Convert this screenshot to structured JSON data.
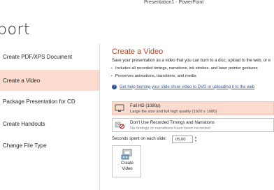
{
  "window": {
    "title": "Presentation1 - PowerPoint"
  },
  "page": {
    "heading": "port"
  },
  "nav": {
    "items": [
      {
        "label": "Create PDF/XPS Document"
      },
      {
        "label": "Create a Video"
      },
      {
        "label": "Package Presentation for CD"
      },
      {
        "label": "Create Handouts"
      },
      {
        "label": "Change File Type"
      }
    ],
    "selected_index": 1
  },
  "main": {
    "title": "Create a Video",
    "description": "Save your presentation as a video that you can burn to a disc, upload to the web, or e",
    "bullets": [
      "Includes all recorded timings, narrations, ink strokes, and laser pointer gestures",
      "Preserves animations, transitions, and media"
    ],
    "help_link": "Get help burning your slide show video to DVD or uploading it to the web",
    "quality": {
      "label": "Full HD (1080p)",
      "detail": "Large file size and full high quality (1920 x 1080)"
    },
    "timings": {
      "label": "Don't Use Recorded Timings and Narrations",
      "detail": "No timings or narrations have been recorded"
    },
    "seconds": {
      "label": "Seconds spent on each slide:",
      "value": "05,00"
    },
    "create_button": {
      "line1": "Create",
      "line2": "Video"
    }
  },
  "colors": {
    "accent": "#c43e1c",
    "selected_bg": "#fcdbcf",
    "link": "#2b579a"
  }
}
